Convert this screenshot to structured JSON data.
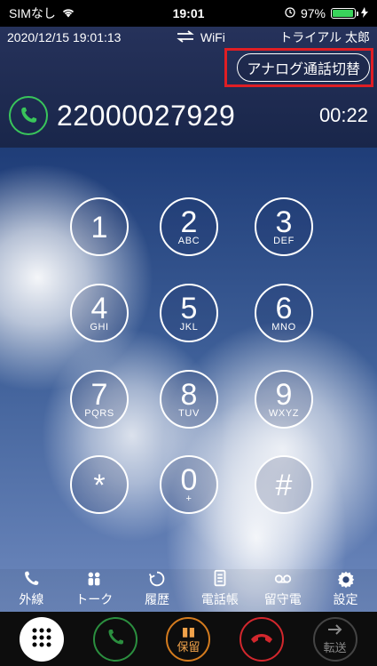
{
  "status_bar": {
    "carrier": "SIMなし",
    "time": "19:01",
    "battery_percent": "97%",
    "battery_level": 0.97,
    "colors": {
      "battery_fill": "#39d35b"
    }
  },
  "info_row": {
    "datetime": "2020/12/15 19:01:13",
    "connection": "WiFi",
    "user_name": "トライアル 太郎"
  },
  "analog_switch_button": {
    "label": "アナログ通話切替"
  },
  "call": {
    "number": "22000027929",
    "duration": "00:22",
    "colors": {
      "phone_icon": "#39c55b"
    }
  },
  "keypad": {
    "keys": [
      {
        "digit": "1",
        "letters": ""
      },
      {
        "digit": "2",
        "letters": "ABC"
      },
      {
        "digit": "3",
        "letters": "DEF"
      },
      {
        "digit": "4",
        "letters": "GHI"
      },
      {
        "digit": "5",
        "letters": "JKL"
      },
      {
        "digit": "6",
        "letters": "MNO"
      },
      {
        "digit": "7",
        "letters": "PQRS"
      },
      {
        "digit": "8",
        "letters": "TUV"
      },
      {
        "digit": "9",
        "letters": "WXYZ"
      },
      {
        "digit": "*",
        "letters": ""
      },
      {
        "digit": "0",
        "letters": "+"
      },
      {
        "digit": "#",
        "letters": ""
      }
    ]
  },
  "tabs": [
    {
      "label": "外線",
      "icon": "phone-icon"
    },
    {
      "label": "トーク",
      "icon": "talk-icon"
    },
    {
      "label": "履歴",
      "icon": "history-icon"
    },
    {
      "label": "電話帳",
      "icon": "phonebook-icon"
    },
    {
      "label": "留守電",
      "icon": "voicemail-icon"
    },
    {
      "label": "設定",
      "icon": "gear-icon"
    }
  ],
  "bottom_actions": {
    "hold_label": "保留",
    "transfer_label": "転送",
    "colors": {
      "call": "#2b8f3f",
      "hold": "#d47b1e",
      "end": "#d2272d",
      "transfer": "#444444"
    }
  }
}
